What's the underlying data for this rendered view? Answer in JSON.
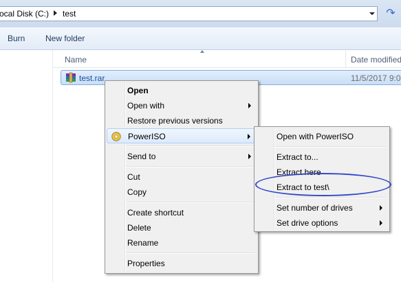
{
  "address": {
    "segments": [
      "ocal Disk (C:)",
      "test"
    ]
  },
  "toolbar": {
    "burn_label": "Burn",
    "new_folder_label": "New folder"
  },
  "columns": {
    "name": "Name",
    "date_modified": "Date modified"
  },
  "file": {
    "name": "test.rar",
    "date": "11/5/2017 9:0"
  },
  "context_menu": {
    "items": {
      "open": "Open",
      "open_with": "Open with",
      "restore": "Restore previous versions",
      "poweriso": "PowerISO",
      "send_to": "Send to",
      "cut": "Cut",
      "copy": "Copy",
      "create_shortcut": "Create shortcut",
      "delete": "Delete",
      "rename": "Rename",
      "properties": "Properties"
    }
  },
  "poweriso_submenu": {
    "items": {
      "open_with_poweriso": "Open with PowerISO",
      "extract_to": "Extract to...",
      "extract_here": "Extract here",
      "extract_to_test": "Extract to test\\",
      "set_drives": "Set number of drives",
      "set_drive_options": "Set drive options"
    }
  },
  "colors": {
    "highlight_border": "#aecff7",
    "annotation_oval": "#3448c8",
    "toolbar_text": "#1e395b"
  }
}
